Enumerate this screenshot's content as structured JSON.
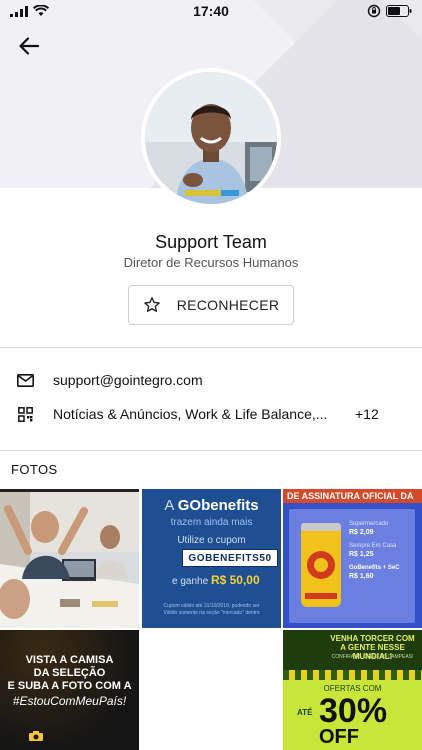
{
  "status_bar": {
    "time": "17:40"
  },
  "profile": {
    "name": "Support Team",
    "role": "Diretor de Recursos Humanos",
    "recognize_label": "RECONHECER"
  },
  "info": {
    "email": "support@gointegro.com",
    "groups": "Notícias & Anúncios, Work & Life Balance,...",
    "groups_extra": "+12"
  },
  "photos": {
    "title": "FOTOS",
    "items": [
      {
        "id": "photo-office",
        "desc": "office"
      },
      {
        "brand_prefix": "A ",
        "brand": "GObenefits",
        "subtitle": "trazem ainda mais",
        "coupon_prompt": "Utilize o cupom",
        "coupon_code": "GOBENEFITS50",
        "reward_prefix": "e ganhe ",
        "reward": "R$ 50,00",
        "fine_print": "Cupom válido até 31/10/2018, podendo ser\nVálido somente na seção \"mercado\" dentro"
      },
      {
        "banner": "DE ASSINATURA OFICIAL DA",
        "price_1_label": "Supermercado",
        "price_1": "R$ 2,09",
        "price_2_label": "Sempre Em Casa",
        "price_2": "R$ 1,25",
        "price_3_label": "GoBenefits + SeC",
        "price_3": "R$ 1,60"
      },
      {
        "line1": "VISTA A CAMISA",
        "line2": "DA SELEÇÃO",
        "line3": "E SUBA A FOTO COM A",
        "hashtag": "#EstouComMeuPaís!"
      },
      {},
      {
        "headline1": "VENHA TORCER COM",
        "headline2": "A GENTE NESSE MUNDIAL!",
        "sub": "CONFIRA AS OFERTAS CAMPEAS!",
        "offers_label": "OFERTAS COM",
        "up_to": "ATÉ",
        "percent": "30%",
        "off": "OFF"
      }
    ]
  },
  "colors": {
    "header_bg": "#e9e9ee",
    "gobenefits_blue": "#1f4f93",
    "promo_blue": "#3551c9",
    "promo_yellow": "#e6d21a",
    "promo_lime": "#c8e63a",
    "promo_green": "#1f3d0c"
  }
}
